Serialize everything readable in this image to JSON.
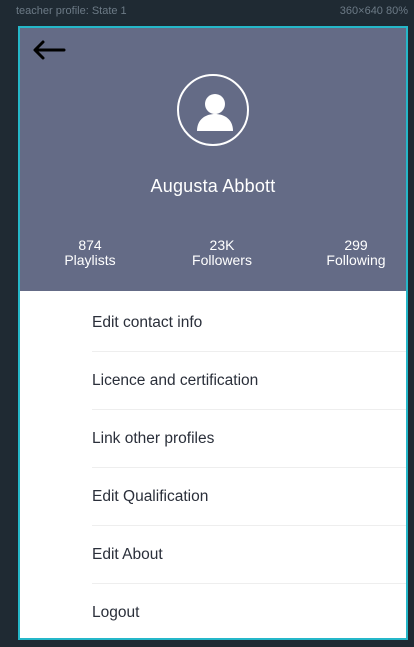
{
  "artboard": {
    "name": "teacher profile: State 1",
    "meta": "360×640  80%"
  },
  "profile": {
    "name": "Augusta Abbott",
    "stats": [
      {
        "value": "874",
        "label": "Playlists"
      },
      {
        "value": "23K",
        "label": "Followers"
      },
      {
        "value": "299",
        "label": "Following"
      }
    ]
  },
  "menu": {
    "items": [
      {
        "label": "Edit contact info"
      },
      {
        "label": "Licence and certification"
      },
      {
        "label": "Link other profiles"
      },
      {
        "label": "Edit Qualification"
      },
      {
        "label": "Edit About"
      },
      {
        "label": "Logout"
      }
    ]
  },
  "icons": {
    "back": "arrow-left-icon",
    "avatar": "user-avatar-icon"
  },
  "colors": {
    "header": "#646b86",
    "frame_border": "#25b7c9",
    "background": "#1f2a33"
  }
}
